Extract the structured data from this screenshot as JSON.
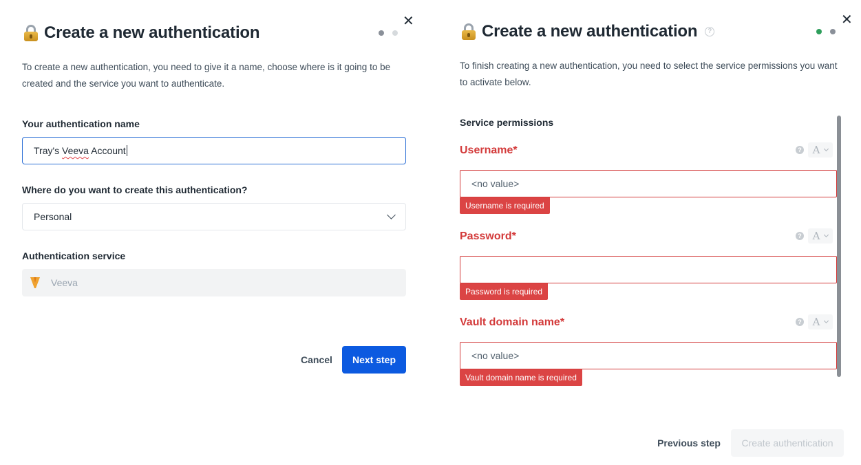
{
  "left": {
    "title": "Create a new authentication",
    "description": "To create a new authentication, you need to give it a name, choose where is it going to be created and the service you want to authenticate.",
    "name_label": "Your authentication name",
    "name_value_before": "Tray's ",
    "name_value_misspelled": "Veeva",
    "name_value_after": " Account",
    "location_label": "Where do you want to create this authentication?",
    "location_value": "Personal",
    "service_label": "Authentication service",
    "service_value": "Veeva",
    "cancel_label": "Cancel",
    "next_label": "Next step",
    "close_icon": "close-icon",
    "step_dot_active_color": "#8a9099",
    "step_dot_inactive_color": "#d6dadd"
  },
  "right": {
    "title": "Create a new authentication",
    "description": "To finish creating a new authentication, you need to select the service permissions you want to activate below.",
    "section_label": "Service permissions",
    "fields": [
      {
        "label": "Username*",
        "placeholder": "<no value>",
        "error": "Username is required"
      },
      {
        "label": "Password*",
        "placeholder": "",
        "error": "Password is required"
      },
      {
        "label": "Vault domain name*",
        "placeholder": "<no value>",
        "error": "Vault domain name is required"
      }
    ],
    "type_chip_letter": "A",
    "help_symbol": "?",
    "previous_label": "Previous step",
    "create_label": "Create authentication",
    "step_dot_done_color": "#2e9e5b",
    "step_dot_current_color": "#8a9099"
  },
  "colors": {
    "primary": "#0c5ae0",
    "error": "#d33a3a",
    "error_bg": "#db4444",
    "focus_border": "#2d6fd6"
  }
}
